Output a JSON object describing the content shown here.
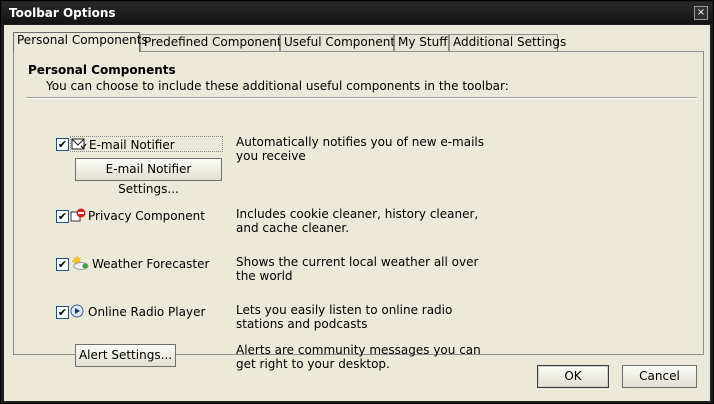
{
  "window": {
    "title": "Toolbar Options",
    "close_glyph": "×"
  },
  "tabs": [
    {
      "label": "Personal Components",
      "active": true
    },
    {
      "label": "Predefined Components",
      "active": false
    },
    {
      "label": "Useful Components",
      "active": false
    },
    {
      "label": "My Stuff",
      "active": false
    },
    {
      "label": "Additional Settings",
      "active": false
    }
  ],
  "panel": {
    "title": "Personal Components",
    "description": "You can choose to include these additional useful components in the toolbar:"
  },
  "components": [
    {
      "label": "E-mail Notifier",
      "checked": true,
      "icon": "email-icon",
      "description": "Automatically notifies you of new e-mails you receive"
    },
    {
      "label": "Privacy Component",
      "checked": true,
      "icon": "privacy-icon",
      "description": "Includes cookie cleaner, history cleaner, and cache cleaner."
    },
    {
      "label": "Weather Forecaster",
      "checked": true,
      "icon": "weather-icon",
      "description": "Shows the current local weather all over the world"
    },
    {
      "label": "Online Radio Player",
      "checked": true,
      "icon": "radio-play-icon",
      "description": "Lets you easily listen to online radio stations and podcasts"
    }
  ],
  "email_settings_button": "E-mail Notifier Settings...",
  "alert": {
    "button": "Alert Settings...",
    "description": "Alerts are community messages you can get right to your desktop."
  },
  "footer": {
    "ok": "OK",
    "cancel": "Cancel"
  },
  "check_glyph": "✔"
}
